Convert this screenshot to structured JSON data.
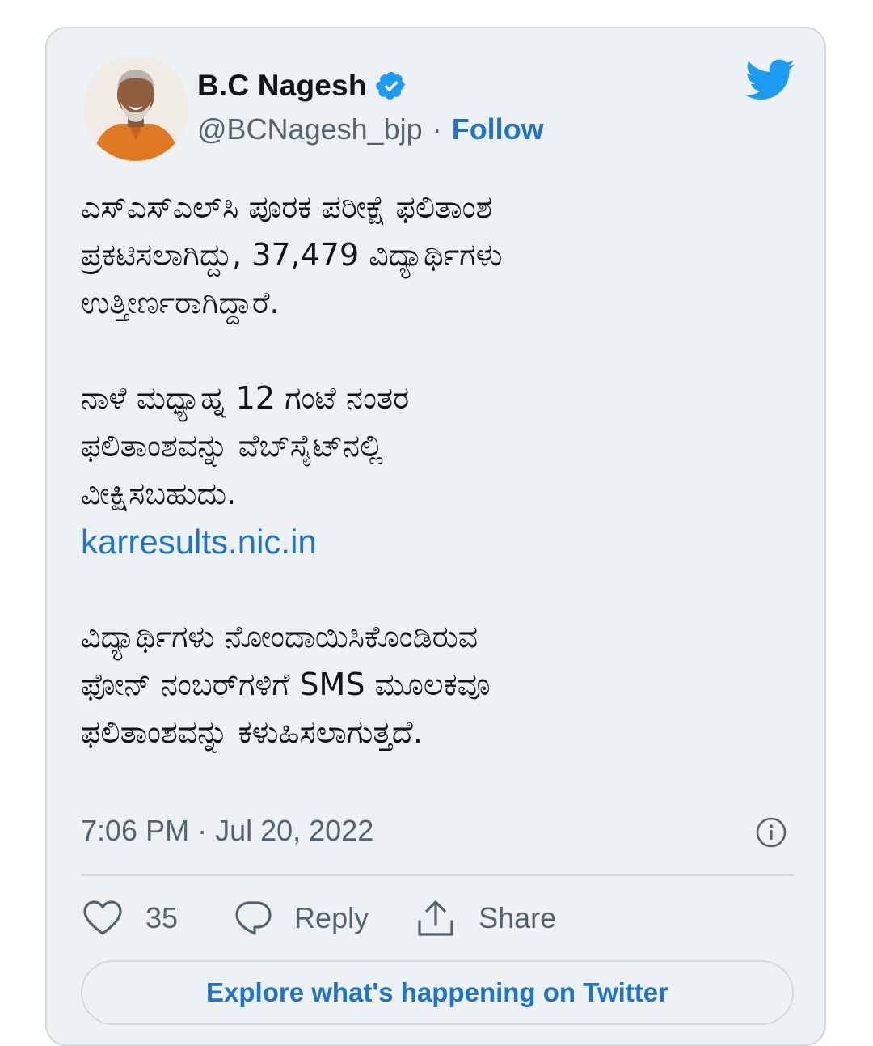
{
  "author": {
    "display_name": "B.C Nagesh",
    "handle": "@BCNagesh_bjp",
    "separator": "·",
    "follow_label": "Follow",
    "verified": true
  },
  "tweet": {
    "paragraph_1": "ಎಸ್‌ಎಸ್‌ಎಲ್‌ಸಿ ಪೂರಕ ಪರೀಕ್ಷೆ ಫಲಿತಾಂಶ\nಪ್ರಕಟಿಸಲಾಗಿದ್ದು, 37,479 ವಿದ್ಯಾರ್ಥಿಗಳು\nಉತ್ತೀರ್ಣರಾಗಿದ್ದಾರೆ.",
    "paragraph_2": "ನಾಳೆ ಮಧ್ಯಾಹ್ನ 12 ಗಂಟೆ ನಂತರ\nಫಲಿತಾಂಶವನ್ನು ವೆಬ್‌ಸೈಟ್‌ನಲ್ಲಿ\nವೀಕ್ಷಿಸಬಹುದು.",
    "link": "karresults.nic.in",
    "paragraph_3": "ವಿದ್ಯಾರ್ಥಿಗಳು ನೋಂದಾಯಿಸಿಕೊಂಡಿರುವ\nಫೋನ್ ನಂಬರ್‌ಗಳಿಗೆ SMS ಮೂಲಕವೂ\nಫಲಿತಾಂಶವನ್ನು ಕಳುಹಿಸಲಾಗುತ್ತದೆ."
  },
  "meta": {
    "time": "7:06 PM",
    "separator": "·",
    "date": "Jul 20, 2022"
  },
  "actions": {
    "like_count": "35",
    "reply_label": "Reply",
    "share_label": "Share"
  },
  "explore_label": "Explore what's happening on Twitter",
  "colors": {
    "accent": "#1d74c8",
    "card_background": "#eef1f3",
    "muted_text": "#536471",
    "twitter_blue": "#1d9bf0"
  }
}
